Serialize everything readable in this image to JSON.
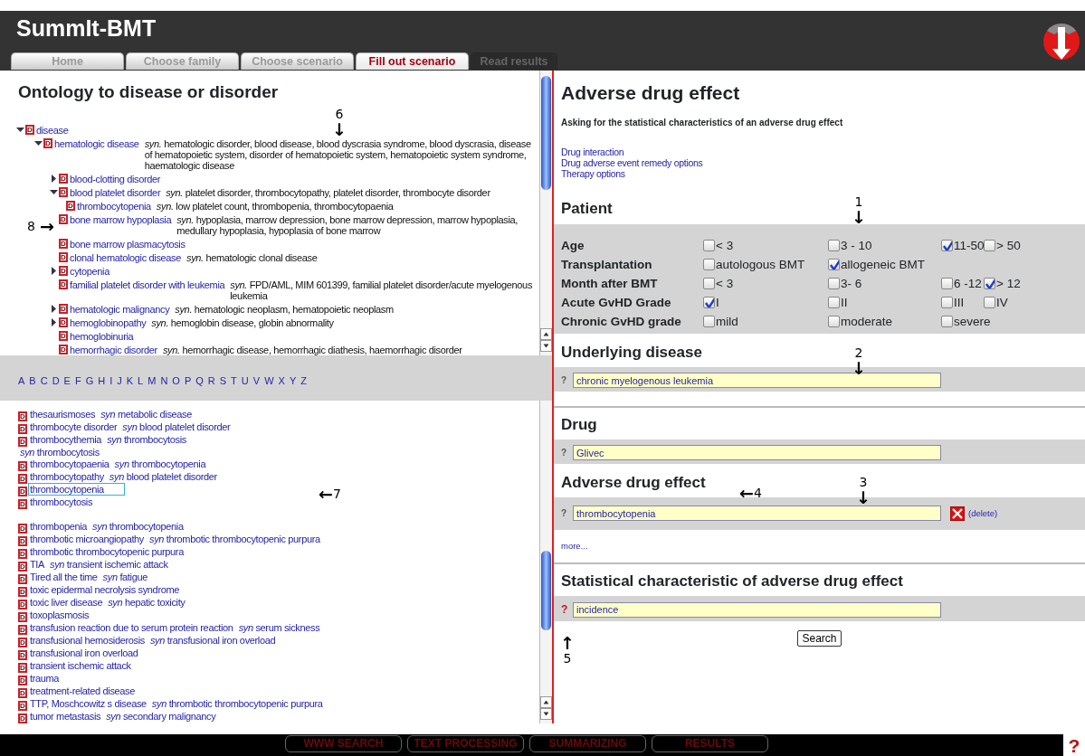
{
  "app_title": "SummIt-BMT",
  "tabs": [
    {
      "label": "Home",
      "selected": false,
      "disabled": false
    },
    {
      "label": "Choose family",
      "selected": false,
      "disabled": false
    },
    {
      "label": "Choose scenario",
      "selected": false,
      "disabled": false
    },
    {
      "label": "Fill out scenario",
      "selected": true,
      "disabled": false
    },
    {
      "label": "Read results",
      "selected": false,
      "disabled": true
    }
  ],
  "ontology": {
    "title": "Ontology to disease or disorder",
    "tree": [
      {
        "badge": "D",
        "term": "disease",
        "expanded": true,
        "children": [
          {
            "badge": "D",
            "term": "hematologic disease",
            "syn": "*syn.* hematologic disorder, blood disease, blood dyscrasia syndrome, blood dyscrasia, disease of hematopoietic system, disorder of hematopoietic system, hematopoietic system syndrome, haematologic disease",
            "expanded": true,
            "children": [
              {
                "badge": "D",
                "term": "blood-clotting disorder",
                "expanded": false
              },
              {
                "badge": "D",
                "term": "blood platelet disorder",
                "syn": "*syn.* platelet disorder, thrombocytopathy, platelet disorder, thrombocyte disorder",
                "expanded": true,
                "children": [
                  {
                    "badge": "D",
                    "term": "thrombocytopenia",
                    "syn": "*syn.* low platelet count, thrombopenia, thrombocytopaenia"
                  }
                ]
              },
              {
                "badge": "D",
                "term": "bone marrow hypoplasia",
                "syn": "*syn.* hypoplasia, marrow depression, bone marrow depression, marrow hypoplasia, medullary hypoplasia, hypoplasia of bone marrow"
              },
              {
                "badge": "D",
                "term": "bone marrow plasmacytosis"
              },
              {
                "badge": "D",
                "term": "clonal hematologic disease",
                "syn": "*syn.* hematologic clonal disease"
              },
              {
                "badge": "D",
                "term": "cytopenia",
                "expanded": false
              },
              {
                "badge": "D",
                "term": "familial platelet disorder with leukemia",
                "syn": "*syn.* FPD/AML, MIM 601399, familial platelet disorder/acute myelogenous leukemia"
              },
              {
                "badge": "D",
                "term": "hematologic malignancy",
                "syn": "*syn.* hematologic neoplasm, hematopoietic neoplasm",
                "expanded": false
              },
              {
                "badge": "D",
                "term": "hemoglobinopathy",
                "syn": "*syn.* hemoglobin disease, globin abnormality",
                "expanded": false
              },
              {
                "badge": "D",
                "term": "hemoglobinuria"
              },
              {
                "badge": "D",
                "term": "hemorrhagic disorder",
                "syn": "*syn.* hemorrhagic disease, hemorrhagic diathesis, haemorrhagic disorder"
              }
            ]
          }
        ]
      }
    ]
  },
  "alphabet": [
    "A",
    "B",
    "C",
    "D",
    "E",
    "F",
    "G",
    "H",
    "I",
    "J",
    "K",
    "L",
    "M",
    "N",
    "O",
    "P",
    "Q",
    "R",
    "S",
    "T",
    "U",
    "V",
    "W",
    "X",
    "Y",
    "Z"
  ],
  "index_groups": [
    [
      {
        "kind": "term",
        "badge": "D",
        "term": "thesaurismoses",
        "syn": "*syn*  metabolic disease",
        "selected": false
      },
      {
        "kind": "term",
        "badge": "D",
        "term": "thrombocyte disorder",
        "syn": "*syn*  blood platelet disorder",
        "selected": false
      },
      {
        "kind": "term",
        "badge": "D",
        "term": "thrombocythemia",
        "syn": "*syn*  thrombocytosis",
        "selected": false
      },
      {
        "kind": "continuation",
        "syn": "*syn*  thrombocytosis"
      },
      {
        "kind": "term",
        "badge": "D",
        "term": "thrombocytopaenia",
        "syn": "*syn*  thrombocytopenia",
        "selected": false
      },
      {
        "kind": "term",
        "badge": "D",
        "term": "thrombocytopathy",
        "syn": "*syn*  blood platelet disorder",
        "selected": false
      },
      {
        "kind": "term",
        "badge": "D",
        "term": "thrombocytopenia",
        "selected": true
      },
      {
        "kind": "term",
        "badge": "D",
        "term": "thrombocytosis",
        "selected": false
      }
    ],
    [
      {
        "kind": "term",
        "badge": "D",
        "term": "thrombopenia",
        "syn": "*syn*  thrombocytopenia",
        "selected": false
      },
      {
        "kind": "term",
        "badge": "D",
        "term": "thrombotic microangiopathy",
        "syn": "*syn*  thrombotic thrombocytopenic purpura",
        "selected": false
      },
      {
        "kind": "term",
        "badge": "D",
        "term": "thrombotic thrombocytopenic purpura",
        "selected": false
      },
      {
        "kind": "term",
        "badge": "D",
        "term": "TIA",
        "syn": "*syn*  transient ischemic attack",
        "selected": false
      },
      {
        "kind": "term",
        "badge": "D",
        "term": "Tired all the time",
        "syn": "*syn*  fatigue",
        "selected": false
      },
      {
        "kind": "term",
        "badge": "D",
        "term": "toxic epidermal necrolysis syndrome",
        "selected": false
      },
      {
        "kind": "term",
        "badge": "D",
        "term": "toxic liver disease",
        "syn": "*syn*  hepatic toxicity",
        "selected": false
      },
      {
        "kind": "term",
        "badge": "D",
        "term": "toxoplasmosis",
        "selected": false
      },
      {
        "kind": "term",
        "badge": "D",
        "term": "transfusion reaction due to serum protein reaction",
        "syn": "*syn*  serum sickness",
        "selected": false
      },
      {
        "kind": "term",
        "badge": "D",
        "term": "transfusional hemosiderosis",
        "syn": "*syn*  transfusional iron overload",
        "selected": false
      },
      {
        "kind": "term",
        "badge": "D",
        "term": "transfusional iron overload",
        "selected": false
      },
      {
        "kind": "term",
        "badge": "D",
        "term": "transient ischemic attack",
        "selected": false
      },
      {
        "kind": "term",
        "badge": "D",
        "term": "trauma",
        "selected": false
      },
      {
        "kind": "term",
        "badge": "D",
        "term": "treatment-related disease",
        "selected": false
      },
      {
        "kind": "term",
        "badge": "D",
        "term": "TTP, Moschcowitz s disease",
        "syn": "*syn*  thrombotic thrombocytopenic purpura",
        "selected": false
      },
      {
        "kind": "term",
        "badge": "D",
        "term": "tumor metastasis",
        "syn": "*syn*  secondary malignancy",
        "selected": false
      }
    ]
  ],
  "form": {
    "title": "Adverse drug effect",
    "subtitle": "Asking for the statistical characteristics of an adverse drug effect",
    "links": [
      "Drug interaction",
      "Drug adverse event remedy options",
      "Therapy options"
    ],
    "patient": {
      "heading": "Patient",
      "rows": [
        {
          "label": "Age",
          "options": [
            {
              "label": "< 3",
              "checked": false
            },
            {
              "label": "3 - 10",
              "checked": false
            },
            {
              "label": "11-50",
              "checked": true
            },
            {
              "label": "> 50",
              "checked": false
            }
          ]
        },
        {
          "label": "Transplantation",
          "options": [
            {
              "label": "autologous BMT",
              "checked": false
            },
            {
              "label": "allogeneic BMT",
              "checked": true
            }
          ]
        },
        {
          "label": "Month after BMT",
          "options": [
            {
              "label": "< 3",
              "checked": false
            },
            {
              "label": "3- 6",
              "checked": false
            },
            {
              "label": "6 -12",
              "checked": false
            },
            {
              "label": "> 12",
              "checked": true
            }
          ]
        },
        {
          "label": "Acute GvHD Grade",
          "options": [
            {
              "label": "I",
              "checked": true
            },
            {
              "label": "II",
              "checked": false
            },
            {
              "label": "III",
              "checked": false
            },
            {
              "label": "IV",
              "checked": false
            }
          ]
        },
        {
          "label": "Chronic GvHD grade",
          "options": [
            {
              "label": "mild",
              "checked": false
            },
            {
              "label": "moderate",
              "checked": false
            },
            {
              "label": "severe",
              "checked": false
            }
          ]
        }
      ]
    },
    "sections": [
      {
        "heading": "Underlying disease",
        "help": "?",
        "help_highlighted": false,
        "value": "chronic myelogenous leukemia",
        "rule_before": false
      },
      {
        "heading": "Drug",
        "help": "?",
        "help_highlighted": false,
        "value": "Glivec",
        "rule_before": true
      },
      {
        "heading": "Adverse drug effect",
        "help": "?",
        "help_highlighted": false,
        "value": "thrombocytopenia",
        "delete_label": "(delete)",
        "more_label": "more...",
        "rule_before": false
      },
      {
        "heading": "Statistical characteristic of adverse drug effect",
        "help": "?",
        "help_highlighted": true,
        "value": "incidence",
        "rule_before": true
      }
    ],
    "search_button": "Search"
  },
  "bottom_buttons": [
    "WWW SEARCH",
    "TEXT PROCESSING",
    "SUMMARIZING",
    "RESULTS"
  ],
  "help_label": "?",
  "annotations": [
    {
      "number": "6",
      "arrow": "↓",
      "kind": "down"
    },
    {
      "number": "1",
      "arrow": "↓",
      "kind": "down"
    },
    {
      "number": "8",
      "arrow": "→",
      "kind": "right"
    },
    {
      "number": "2",
      "arrow": "↓",
      "kind": "down"
    },
    {
      "number": "7",
      "arrow": "←",
      "kind": "left"
    },
    {
      "number": "4",
      "arrow": "←",
      "kind": "left"
    },
    {
      "number": "3",
      "arrow": "↓",
      "kind": "down"
    },
    {
      "number": "5",
      "arrow": "↑",
      "kind": "up"
    }
  ]
}
